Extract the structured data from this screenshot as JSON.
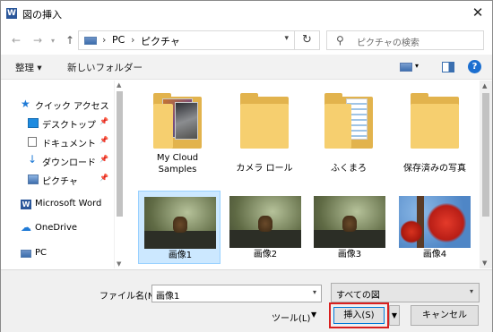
{
  "window": {
    "title": "図の挿入",
    "app_icon": "W"
  },
  "address": {
    "items": [
      "PC",
      "ピクチャ"
    ]
  },
  "search": {
    "placeholder": "ピクチャの検索"
  },
  "toolbar": {
    "organize": "整理 ▾",
    "new_folder": "新しいフォルダー",
    "help": "?"
  },
  "sidebar": {
    "items": [
      {
        "label": "クイック アクセス",
        "icon": "star-icon",
        "pinned": false
      },
      {
        "label": "デスクトップ",
        "icon": "desktop-icon",
        "pinned": true
      },
      {
        "label": "ドキュメント",
        "icon": "document-icon",
        "pinned": true
      },
      {
        "label": "ダウンロード",
        "icon": "download-icon",
        "pinned": true
      },
      {
        "label": "ピクチャ",
        "icon": "pictures-icon",
        "pinned": true
      },
      {
        "label": "Microsoft Word",
        "icon": "word-icon",
        "pinned": false
      },
      {
        "label": "OneDrive",
        "icon": "cloud-icon",
        "pinned": false
      },
      {
        "label": "PC",
        "icon": "pc-icon",
        "pinned": false
      }
    ]
  },
  "files": {
    "folders": [
      {
        "label": "My Cloud Samples"
      },
      {
        "label": "カメラ ロール"
      },
      {
        "label": "ふくまろ"
      },
      {
        "label": "保存済みの写真"
      }
    ],
    "images": [
      {
        "label": "画像1",
        "selected": true
      },
      {
        "label": "画像2",
        "selected": false
      },
      {
        "label": "画像3",
        "selected": false
      },
      {
        "label": "画像4",
        "selected": false
      }
    ]
  },
  "bottom": {
    "filename_label": "ファイル名(N):",
    "filename_value": "画像1",
    "filetype_value": "すべての図",
    "tools_label": "ツール(L)",
    "insert_label": "挿入(S)",
    "cancel_label": "キャンセル"
  },
  "colors": {
    "highlight": "#d9201f",
    "selection": "#cce8ff",
    "folder": "#f6cf6f"
  }
}
